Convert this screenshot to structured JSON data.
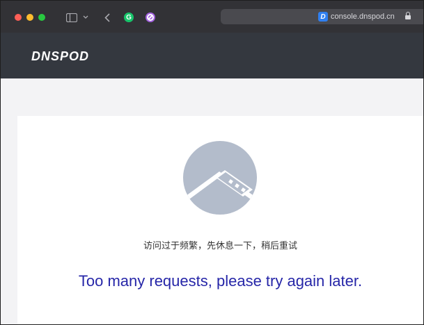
{
  "browser": {
    "url": "console.dnspod.cn",
    "favicon_letter": "D",
    "extension_g_letter": "G",
    "icons": [
      "sidebar-icon",
      "chevron-down-icon",
      "back-icon",
      "grammarly-icon",
      "blocker-icon",
      "lock-icon"
    ],
    "colors": {
      "chrome": "#323236",
      "address_bar": "#4a4a4f"
    }
  },
  "site": {
    "logo": "DNSPOD",
    "header_color": "#34383f"
  },
  "error": {
    "message_cn": "访问过于频繁，先休息一下，稍后重试",
    "message_en": "Too many requests, please try again later.",
    "illustration": "broken-window-icon",
    "message_en_color": "#2626a8"
  }
}
